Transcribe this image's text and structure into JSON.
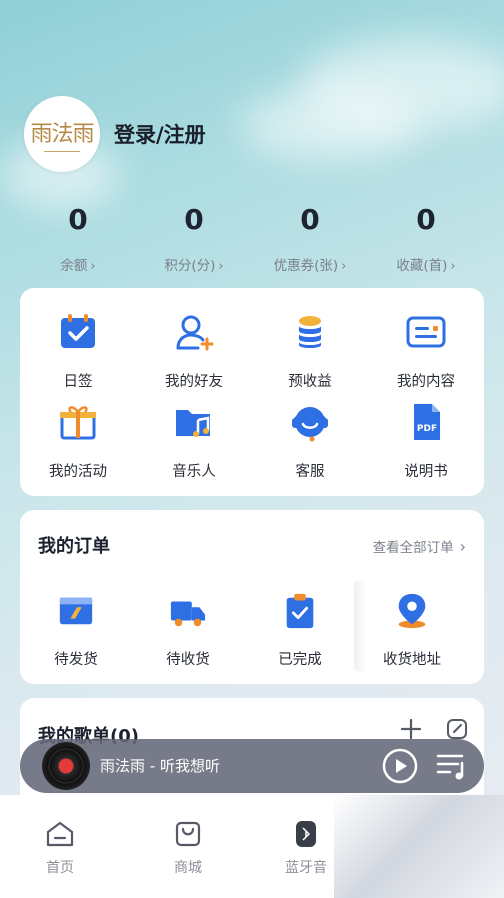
{
  "profile": {
    "avatar_text": "雨法雨",
    "login_label": "登录/注册"
  },
  "stats": [
    {
      "value": "0",
      "label": "余额"
    },
    {
      "value": "0",
      "label": "积分(分)"
    },
    {
      "value": "0",
      "label": "优惠券(张)"
    },
    {
      "value": "0",
      "label": "收藏(首)"
    }
  ],
  "features": [
    {
      "label": "日签",
      "icon": "calendar-check-icon"
    },
    {
      "label": "我的好友",
      "icon": "add-friend-icon"
    },
    {
      "label": "预收益",
      "icon": "coin-stack-icon"
    },
    {
      "label": "我的内容",
      "icon": "content-card-icon"
    },
    {
      "label": "我的活动",
      "icon": "gift-icon"
    },
    {
      "label": "音乐人",
      "icon": "music-folder-icon"
    },
    {
      "label": "客服",
      "icon": "headset-icon"
    },
    {
      "label": "说明书",
      "icon": "pdf-file-icon"
    }
  ],
  "orders": {
    "title": "我的订单",
    "view_all": "查看全部订单",
    "items": [
      {
        "label": "待发货",
        "icon": "package-send-icon"
      },
      {
        "label": "待收货",
        "icon": "delivery-truck-icon"
      },
      {
        "label": "已完成",
        "icon": "clipboard-check-icon"
      },
      {
        "label": "收货地址",
        "icon": "location-pin-icon"
      }
    ]
  },
  "playlist": {
    "title": "我的歌单(0)"
  },
  "player": {
    "now_playing": "雨法雨 - 听我想听"
  },
  "tabs": [
    {
      "label": "首页",
      "icon": "home-icon"
    },
    {
      "label": "商城",
      "icon": "shopping-bag-icon"
    },
    {
      "label": "蓝牙音",
      "icon": "bluetooth-speaker-icon"
    }
  ],
  "colors": {
    "accent": "#2f6fe4",
    "orange": "#f08c2a",
    "yellow": "#f2b23a"
  }
}
